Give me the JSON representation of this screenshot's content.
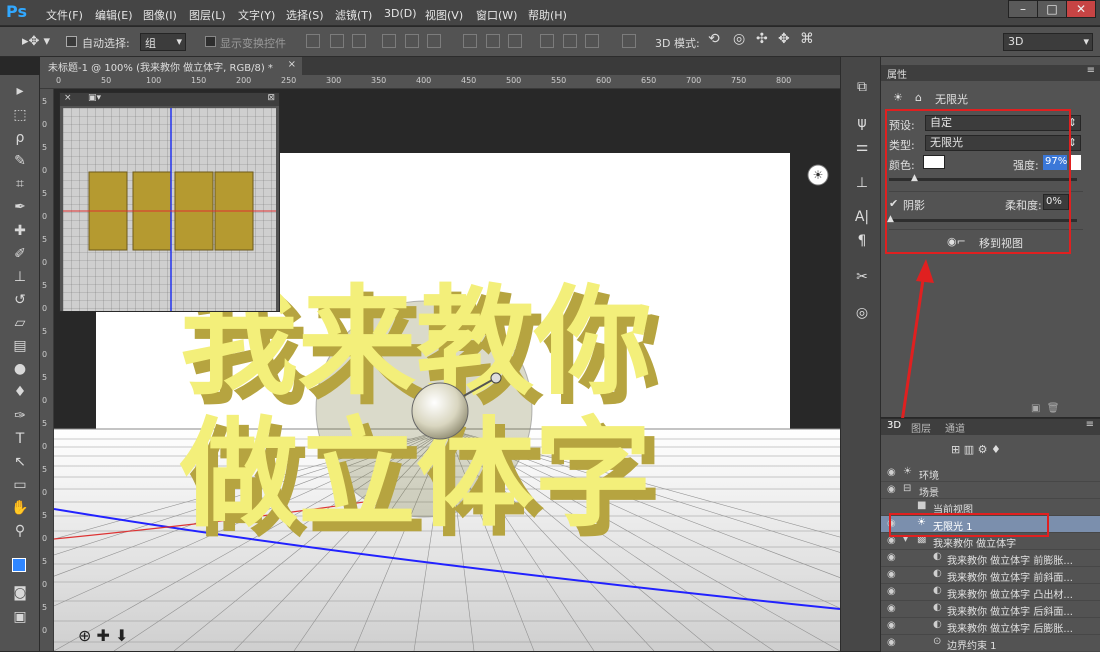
{
  "app": {
    "logo": "Ps"
  },
  "menu": [
    "文件(F)",
    "编辑(E)",
    "图像(I)",
    "图层(L)",
    "文字(Y)",
    "选择(S)",
    "滤镜(T)",
    "3D(D)",
    "视图(V)",
    "窗口(W)",
    "帮助(H)"
  ],
  "window_buttons": [
    "–",
    "□",
    "✕"
  ],
  "options": {
    "auto_select_label": "自动选择:",
    "auto_select_value": "组",
    "show_transform_label": "显示变换控件",
    "mode_label": "3D 模式:",
    "workspace": "3D"
  },
  "document": {
    "tab_title": "未标题-1 @ 100% (我来教你 做立体字, RGB/8) *",
    "text_line1": "我来教你",
    "text_line2": "做立体字"
  },
  "ruler_ticks": [
    "0",
    "50",
    "100",
    "150",
    "200",
    "250",
    "300",
    "350",
    "400",
    "450",
    "500",
    "550",
    "600",
    "650",
    "700",
    "750",
    "800"
  ],
  "ruler_left_ticks": [
    "5",
    "0",
    "5",
    "0",
    "5",
    "0",
    "5",
    "0",
    "5",
    "0",
    "5",
    "0",
    "5",
    "0",
    "5",
    "0",
    "5",
    "0",
    "5",
    "0",
    "5",
    "0",
    "5",
    "0"
  ],
  "properties": {
    "tab": "属性",
    "title": "无限光",
    "preset_label": "预设:",
    "preset_value": "自定",
    "type_label": "类型:",
    "type_value": "无限光",
    "color_label": "颜色:",
    "intensity_label": "强度:",
    "intensity_value": "97%",
    "shadow_label": "阴影",
    "softness_label": "柔和度:",
    "softness_value": "0%",
    "move_to_view": "移到视图"
  },
  "layers_panel": {
    "tabs": [
      "3D",
      "图层",
      "通道"
    ],
    "items": [
      {
        "label": "环境",
        "icon": "environment-icon",
        "indent": 0,
        "selected": false
      },
      {
        "label": "场景",
        "icon": "scene-icon",
        "indent": 0,
        "selected": false
      },
      {
        "label": "当前视图",
        "icon": "camera-icon",
        "indent": 1,
        "selected": false
      },
      {
        "label": "无限光 1",
        "icon": "infinite-light-icon",
        "indent": 1,
        "selected": true
      },
      {
        "label": "我来教你 做立体字",
        "icon": "mesh-icon",
        "indent": 1,
        "selected": false
      },
      {
        "label": "我来教你 做立体字 前膨胀...",
        "icon": "material-icon",
        "indent": 2,
        "selected": false
      },
      {
        "label": "我来教你 做立体字 前斜面...",
        "icon": "material-icon",
        "indent": 2,
        "selected": false
      },
      {
        "label": "我来教你 做立体字 凸出材...",
        "icon": "material-icon",
        "indent": 2,
        "selected": false
      },
      {
        "label": "我来教你 做立体字 后斜面...",
        "icon": "material-icon",
        "indent": 2,
        "selected": false
      },
      {
        "label": "我来教你 做立体字 后膨胀...",
        "icon": "material-icon",
        "indent": 2,
        "selected": false
      },
      {
        "label": "边界约束 1",
        "icon": "constraint-icon",
        "indent": 2,
        "selected": false
      }
    ]
  },
  "colors": {
    "accent": "#31a8ff",
    "text_face": "#f3ef7a",
    "text_side": "#b6a440",
    "highlight": "#e02020"
  }
}
